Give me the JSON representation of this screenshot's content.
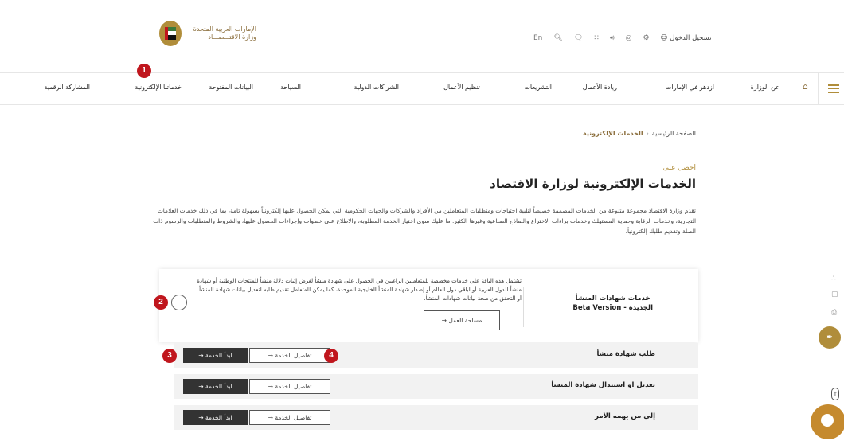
{
  "header": {
    "logo_line1": "الإمارات العربية المتحدة",
    "logo_line2": "وزارة الاقتـــصـــاد",
    "lang": "En",
    "login": "تسجيل الدخول"
  },
  "nav": {
    "items": [
      "عن الوزارة",
      "ازدهر في الإمارات",
      "ريادة الأعمال",
      "التشريعات",
      "تنظيم الأعمال",
      "الشراكات الدولية",
      "السياحة",
      "البيانات المفتوحة",
      "خدماتنا الإلكترونية",
      "المشاركة الرقمية"
    ]
  },
  "markers": [
    "1",
    "2",
    "3",
    "4"
  ],
  "breadcrumb": {
    "home": "الصفحة الرئيسية",
    "current": "الخدمات الإلكترونية"
  },
  "page": {
    "subtitle": "احصل على",
    "title": "الخدمات الإلكترونية لوزارة الاقتصاد",
    "intro": "تقدم وزارة الاقتصاد مجموعة متنوعة من الخدمات المصممة خصيصاً لتلبية احتياجات ومتطلبات المتعاملين من الأفراد والشركات والجهات الحكومية التي يمكن الحصول عليها إلكترونياً بسهولة تامة، بما في ذلك خدمات العلامات التجارية، وخدمات الرقابة وحماية المستهلك وخدمات براءات الاختراع والنماذج الصناعية وغيرها الكثير. ما عليك سوى اختيار الخدمة المطلوبة، والاطلاع على خطوات وإجراءات الحصول عليها، والشروط والمتطلبات والرسوم ذات الصلة وتقديم طلبك إلكترونياً."
  },
  "card": {
    "title_line1": "خدمات شهادات المنشأ",
    "title_line2": "Beta Version - الجديدة",
    "description": "تشتمل هذه الباقة على خدمات مخصصة للمتعاملين الراغبين في الحصول على شهادة منشأ لغرض إثبات دلالة منشأ للمنتجات الوطنية أو شهادة منشأ للدول العربية أو لباقي دول العالم أو إصدار شهادة المنشأ الخليجية الموحدة، كما يمكن للمتعامل تقديم طلبه لتعديل بيانات شهادة المنشأ أو التحقق من صحة بيانات شهادات المنشأ.",
    "workspace_button": "مساحة العمل",
    "collapse_symbol": "–"
  },
  "services": [
    {
      "title": "طلب شهادة منشأ",
      "start": "ابدأ الخدمة",
      "details": "تفاصيل الخدمة"
    },
    {
      "title": "تعديل او استبدال شهادة المنشأ",
      "start": "ابدأ الخدمة",
      "details": "تفاصيل الخدمة"
    },
    {
      "title": "إلى من يهمه الأمر",
      "start": "ابدأ الخدمة",
      "details": "تفاصيل الخدمة"
    }
  ],
  "colors": {
    "gold": "#b08d3a",
    "marker_red": "#c0161d",
    "dark_button": "#333333"
  }
}
